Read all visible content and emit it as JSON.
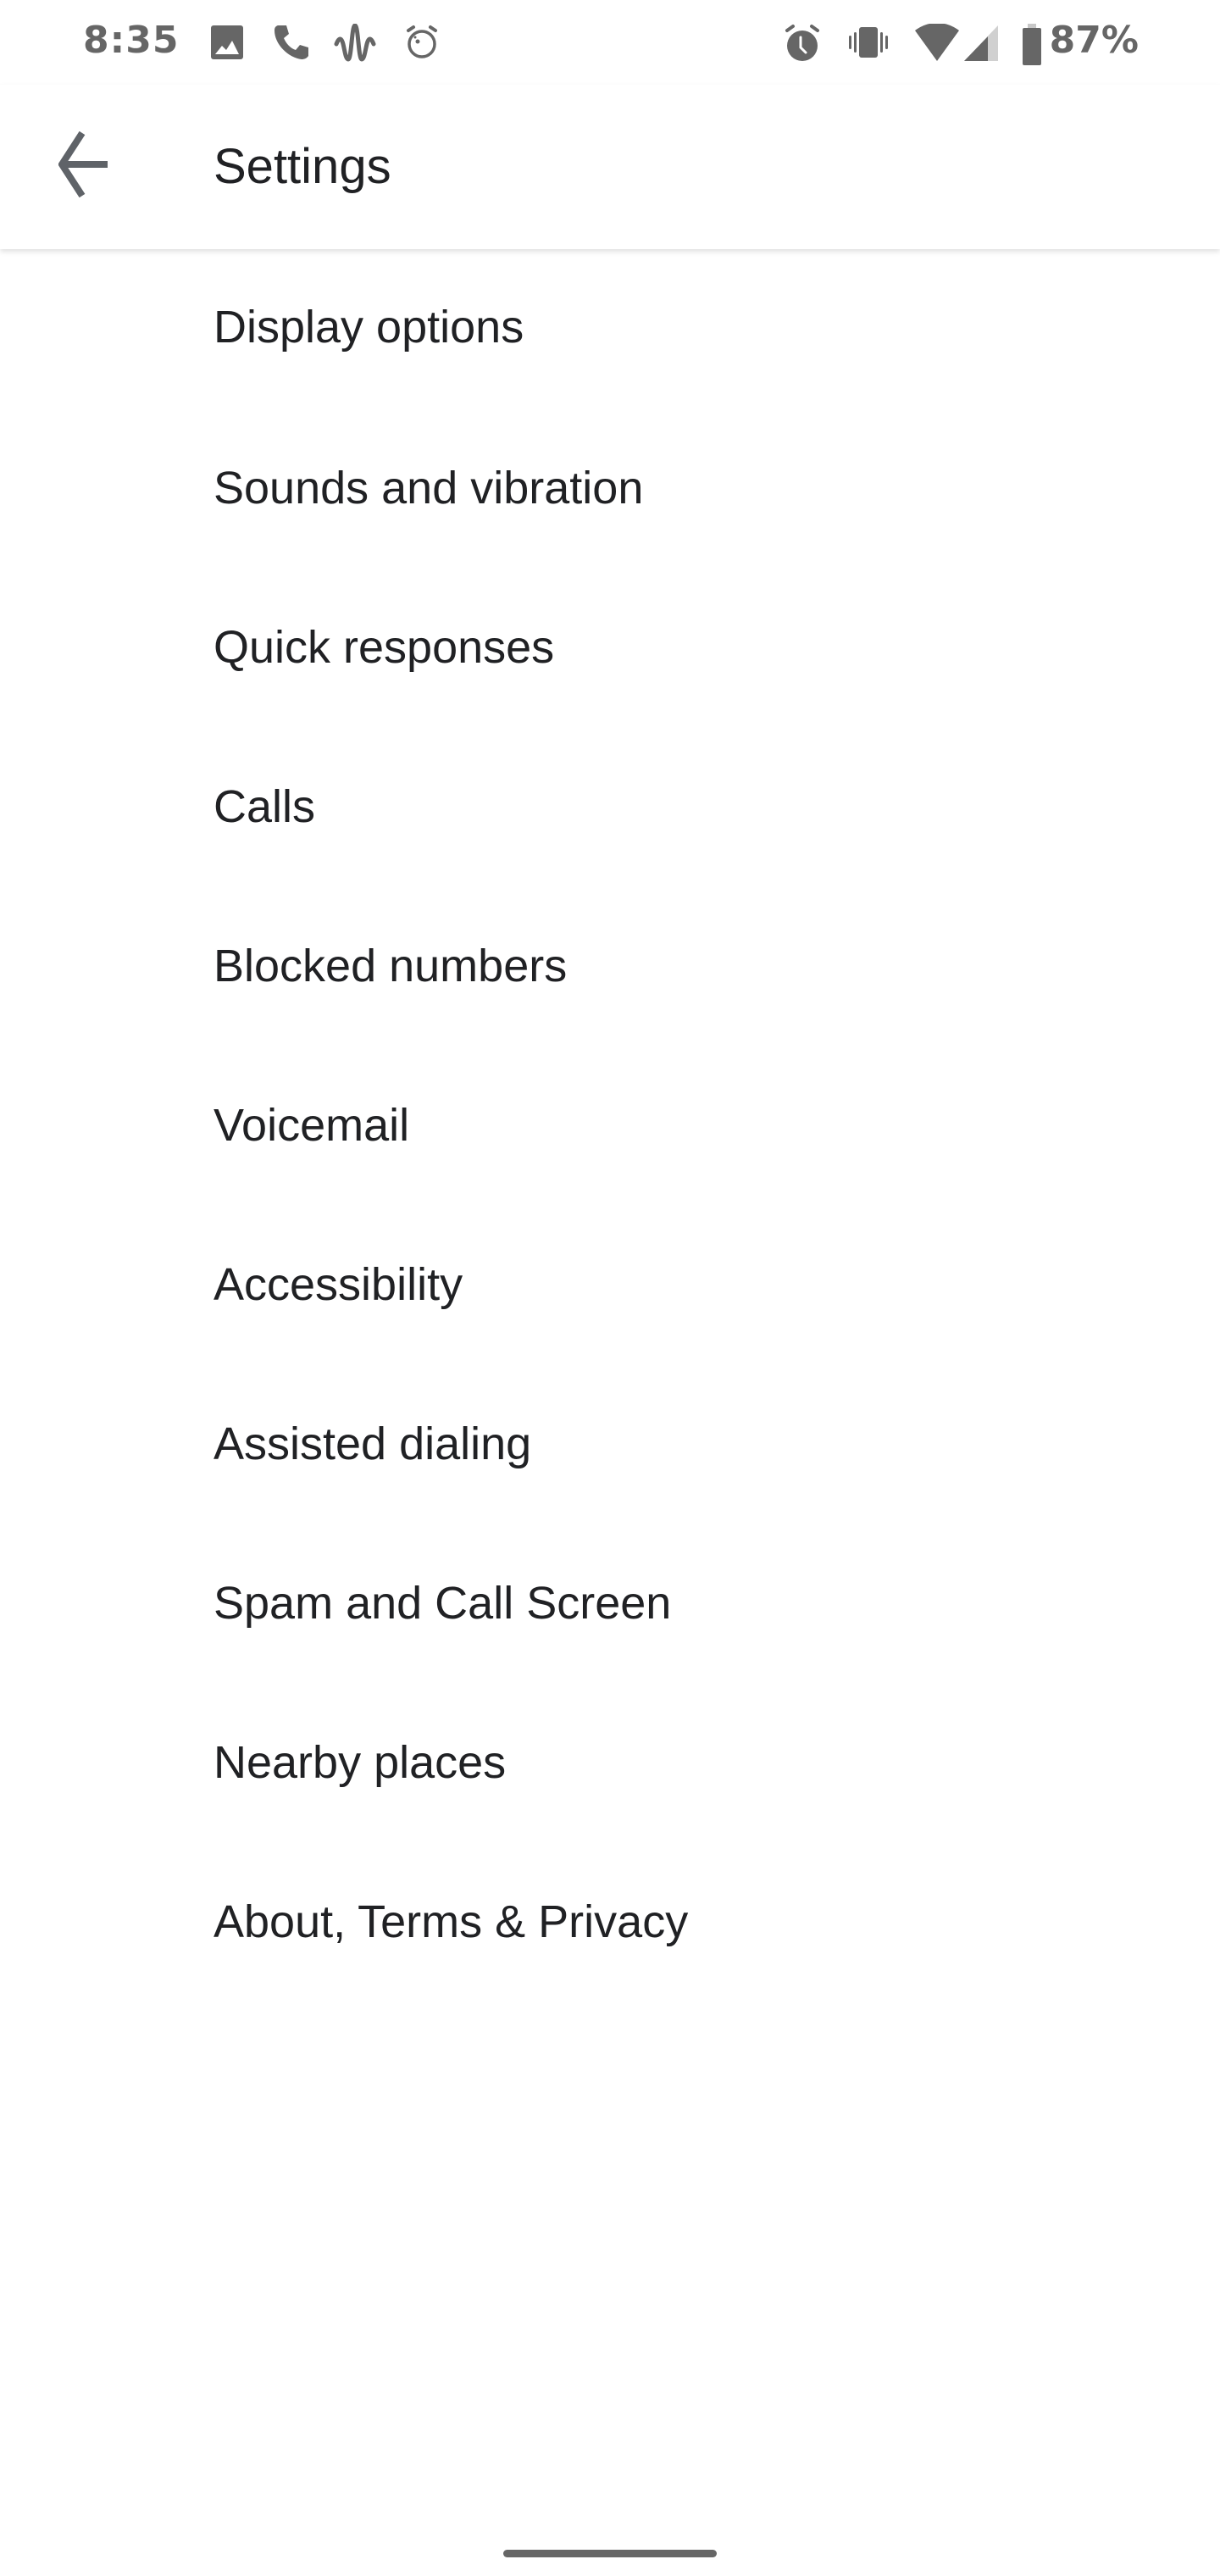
{
  "status_bar": {
    "time": "8:35",
    "left_icons": [
      "image-icon",
      "phone-icon",
      "sound-wave-icon",
      "alarm-outline-icon"
    ],
    "right_icons": [
      "alarm-icon",
      "vibrate-icon",
      "wifi-icon",
      "cell-signal-icon",
      "battery-icon"
    ],
    "battery_percent": "87%",
    "icon_color": "#666666"
  },
  "app_bar": {
    "back_icon": "arrow-back-icon",
    "title": "Settings"
  },
  "settings": {
    "items": [
      {
        "label": "Display options"
      },
      {
        "label": "Sounds and vibration"
      },
      {
        "label": "Quick responses"
      },
      {
        "label": "Calls"
      },
      {
        "label": "Blocked numbers"
      },
      {
        "label": "Voicemail"
      },
      {
        "label": "Accessibility"
      },
      {
        "label": "Assisted dialing"
      },
      {
        "label": "Spam and Call Screen"
      },
      {
        "label": "Nearby places"
      },
      {
        "label": "About, Terms & Privacy"
      }
    ]
  },
  "colors": {
    "text_primary": "#202124",
    "status_icons": "#666666",
    "background": "#ffffff"
  }
}
